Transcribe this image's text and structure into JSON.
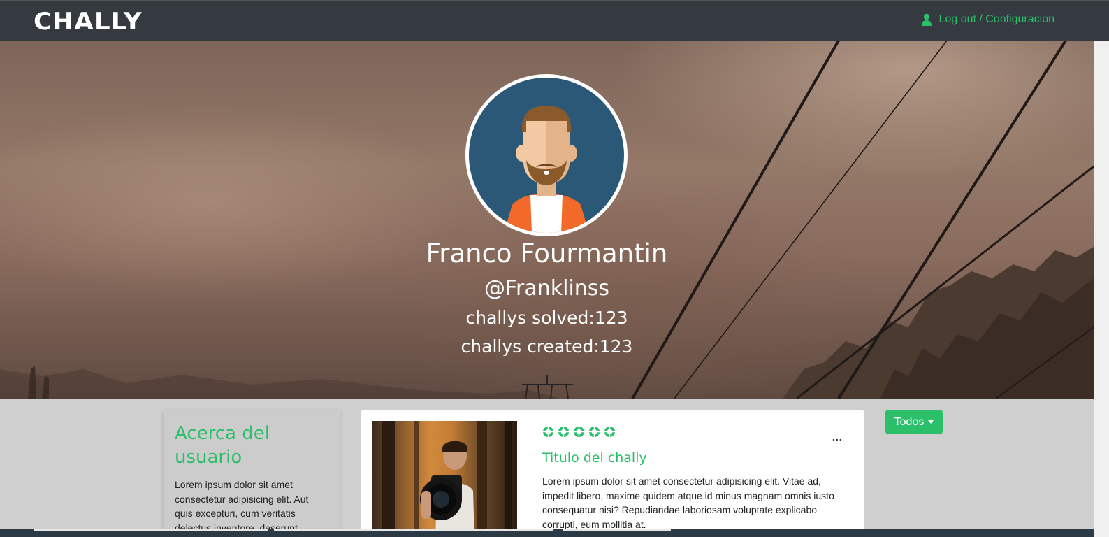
{
  "navbar": {
    "logo": "CHALLY",
    "account_link": "Log out / Configuracion",
    "account_icon": "user-icon"
  },
  "profile": {
    "name": "Franco Fourmantin",
    "handle": "@Franklinss",
    "solved": "challys solved:123",
    "created": "challys created:123",
    "avatar": "bearded-man-avatar"
  },
  "about": {
    "title": "Acerca del usuario",
    "text": "Lorem ipsum dolor sit amet consectetur adipisicing elit. Aut quis excepturi, cum veritatis delectus inventore, deserunt"
  },
  "chally": {
    "rating": 5,
    "menu": "...",
    "title": "Titulo del chally",
    "description": "Lorem ipsum dolor sit amet consectetur adipisicing elit. Vitae ad, impedit libero, maxime quidem atque id minus magnam omnis iusto consequatur nisi? Repudiandae laboriosam voluptate explicabo corrupti, eum mollitia at.",
    "image": "photographer-in-forest"
  },
  "filter": {
    "label": "Todos"
  },
  "colors": {
    "accent": "#2bbf6a",
    "navbar": "#343a40",
    "avatar_bg": "#2b5877"
  }
}
